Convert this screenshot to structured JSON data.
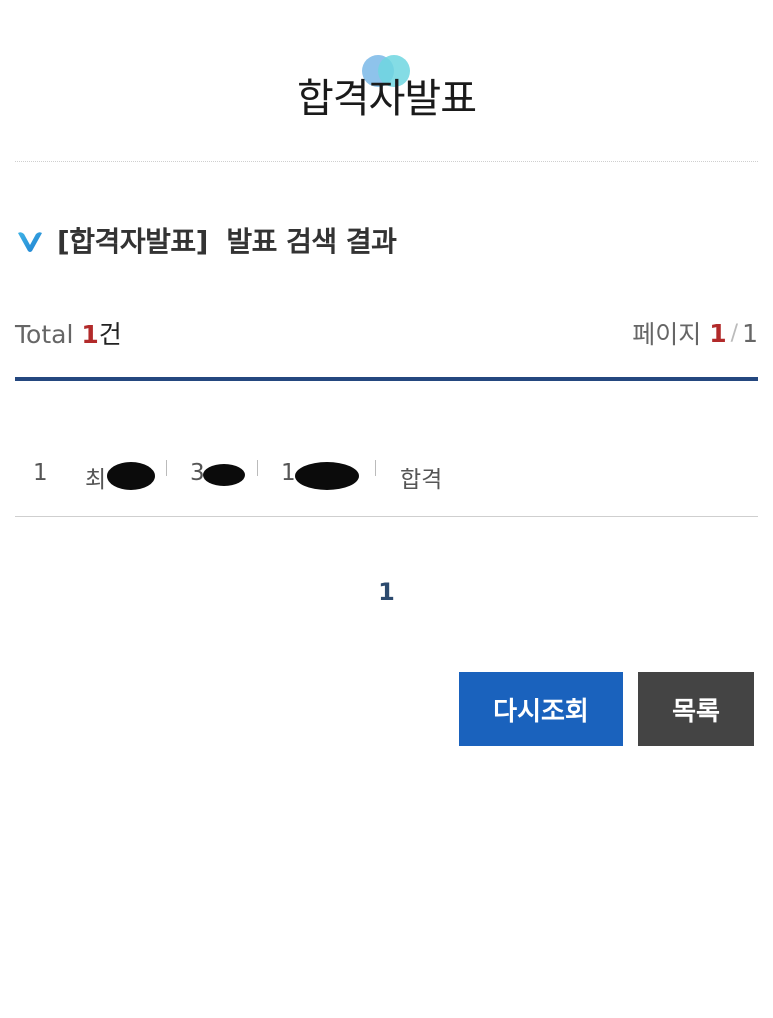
{
  "header": {
    "title": "합격자발표"
  },
  "section": {
    "title": "[합격자발표]  발표 검색 결과"
  },
  "summary": {
    "total_label": "Total ",
    "total_count": "1",
    "total_unit": "건",
    "page_label": "페이지",
    "page_current": "1",
    "page_separator": "/",
    "page_total": "1"
  },
  "results": [
    {
      "no": "1",
      "name_visible": "최",
      "reg_visible": "3",
      "id_visible": "1",
      "result": "합격"
    }
  ],
  "pagination": {
    "current": "1"
  },
  "actions": {
    "retry_label": "다시조회",
    "list_label": "목록"
  },
  "colors": {
    "accent_blue": "#1a62bd",
    "rule_navy": "#24477f",
    "count_red": "#b22a2a",
    "list_button": "#444444"
  }
}
